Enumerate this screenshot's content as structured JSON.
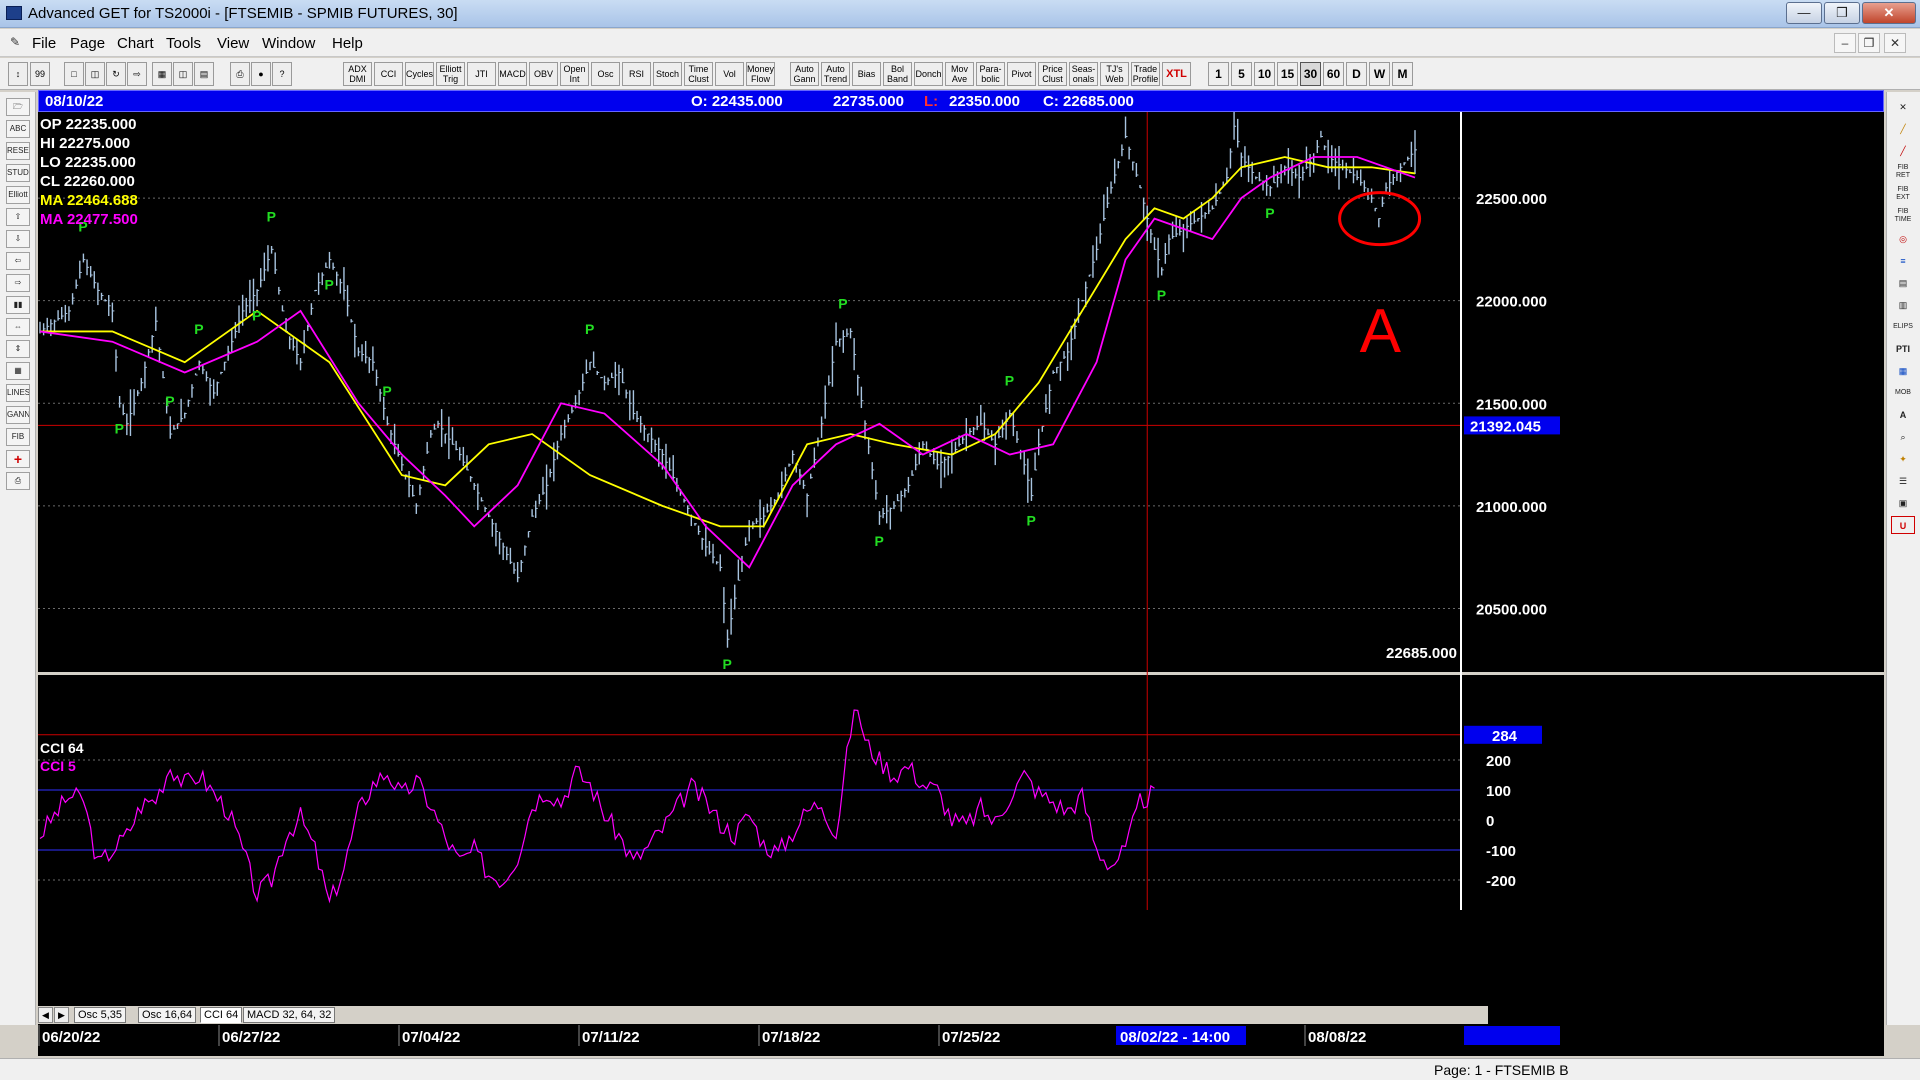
{
  "window": {
    "title": "Advanced GET for TS2000i - [FTSEMIB - SPMIB FUTURES, 30]",
    "minimize": "—",
    "restore": "❒",
    "close": "✕"
  },
  "menu": {
    "items": [
      "File",
      "Page",
      "Chart",
      "Tools",
      "View",
      "Window",
      "Help"
    ],
    "mdi_buttons": [
      "–",
      "❒",
      "✕"
    ]
  },
  "toolbar": {
    "indicator_buttons": [
      "ADX DMI",
      "CCI",
      "Cycles",
      "Elliott Trig",
      "JTI",
      "MACD",
      "OBV",
      "Open Int",
      "Osc",
      "RSI",
      "Stoch",
      "Time Clust",
      "Vol",
      "Money Flow",
      "Auto Gann",
      "Auto Trend",
      "Bias",
      "Bol Band",
      "Donch",
      "Mov Ave",
      "Para-bolic",
      "Pivot",
      "Price Clust",
      "Seas-onals",
      "TJ's Web",
      "Trade Profile",
      "XTL"
    ],
    "interval_buttons": [
      "1",
      "5",
      "10",
      "15",
      "30",
      "60",
      "D",
      "W",
      "M"
    ],
    "active_interval": "30"
  },
  "left_tools": [
    "open-folder",
    "ABC",
    "RESET",
    "STUDY",
    "Elliott",
    "⇧",
    "⇩",
    "⇦",
    "⇨",
    "bars",
    "⇔",
    "⇕",
    "grid",
    "LINES",
    "GANN",
    "FIB",
    "+",
    "print"
  ],
  "right_tools": [
    "✕",
    "╱",
    "╱",
    "FIB RET",
    "FIB EXT",
    "FIB TIME",
    "◎",
    "≡",
    "▤",
    "▥",
    "ELIPS",
    "PTI",
    "▦",
    "MOB",
    "A",
    "⌕",
    "✦",
    "☰",
    "▣",
    "U"
  ],
  "info_bar": {
    "date": "08/10/22",
    "open": "O: 22435.000",
    "high": "22735.000",
    "low_label": "L:",
    "low": "22350.000",
    "close": "C: 22685.000"
  },
  "readouts": {
    "op": "OP  22235.000",
    "hi": "HI   22275.000",
    "lo": "LO  22235.000",
    "cl": "CL  22260.000",
    "ma1": "MA  22464.688",
    "ma2": "MA  22477.500"
  },
  "price_axis": {
    "labels": [
      "22500.000",
      "22000.000",
      "21500.000",
      "21000.000",
      "20500.000"
    ],
    "cursor_price": "21392.045",
    "last_price": "22685.000"
  },
  "cci_panel": {
    "label1": "CCI 64",
    "label2": "CCI  5",
    "axis_labels": [
      "200",
      "100",
      "0",
      "-100",
      "-200"
    ],
    "cursor_value": "284"
  },
  "pivot_marker": "P",
  "annotation_letter": "A",
  "tabs": [
    "Osc 5,35",
    "Osc 16,64",
    "CCI 64",
    "MACD 32, 64, 32"
  ],
  "active_tab": "CCI 64",
  "tab_nav": [
    "◀",
    "▶"
  ],
  "date_axis": {
    "labels": [
      "06/20/22",
      "06/27/22",
      "07/04/22",
      "07/11/22",
      "07/18/22",
      "07/25/22",
      "08/08/22"
    ],
    "cursor_label": "08/02/22 - 14:00"
  },
  "status": "Page: 1 - FTSEMIB B",
  "colors": {
    "price_bars": "#a8c4e0",
    "ma_fast": "#ffff00",
    "ma_slow": "#ff00ff",
    "pivot": "#22dd22",
    "cursor_line": "#cc0000",
    "annotation": "#ff0000",
    "info_bar": "#0000ee"
  },
  "chart_data": {
    "type": "line",
    "title": "FTSEMIB - SPMIB FUTURES, 30",
    "x_range": [
      "06/20/22",
      "08/10/22"
    ],
    "y_range": [
      20200,
      22900
    ],
    "series": [
      {
        "name": "Price",
        "points": [
          [
            0,
            21850
          ],
          [
            2,
            21900
          ],
          [
            4,
            21950
          ],
          [
            6,
            22200
          ],
          [
            8,
            22050
          ],
          [
            10,
            21950
          ],
          [
            11,
            21500
          ],
          [
            12,
            21400
          ],
          [
            14,
            21600
          ],
          [
            16,
            21900
          ],
          [
            18,
            21350
          ],
          [
            20,
            21450
          ],
          [
            22,
            21700
          ],
          [
            24,
            21550
          ],
          [
            26,
            21750
          ],
          [
            28,
            21950
          ],
          [
            30,
            22050
          ],
          [
            32,
            22250
          ],
          [
            34,
            21850
          ],
          [
            36,
            21700
          ],
          [
            38,
            22050
          ],
          [
            40,
            22200
          ],
          [
            42,
            22050
          ],
          [
            44,
            21750
          ],
          [
            46,
            21700
          ],
          [
            48,
            21400
          ],
          [
            50,
            21200
          ],
          [
            52,
            21000
          ],
          [
            54,
            21350
          ],
          [
            55,
            21400
          ],
          [
            56,
            21350
          ],
          [
            58,
            21250
          ],
          [
            60,
            21100
          ],
          [
            62,
            20950
          ],
          [
            64,
            20800
          ],
          [
            66,
            20650
          ],
          [
            68,
            20950
          ],
          [
            70,
            21100
          ],
          [
            72,
            21350
          ],
          [
            74,
            21500
          ],
          [
            76,
            21700
          ],
          [
            78,
            21600
          ],
          [
            80,
            21650
          ],
          [
            82,
            21450
          ],
          [
            84,
            21350
          ],
          [
            86,
            21250
          ],
          [
            88,
            21100
          ],
          [
            90,
            20950
          ],
          [
            92,
            20800
          ],
          [
            94,
            20700
          ],
          [
            95,
            20350
          ],
          [
            96,
            20550
          ],
          [
            98,
            20900
          ],
          [
            100,
            20950
          ],
          [
            102,
            21050
          ],
          [
            104,
            21250
          ],
          [
            106,
            21050
          ],
          [
            108,
            21400
          ],
          [
            110,
            21800
          ],
          [
            112,
            21850
          ],
          [
            114,
            21400
          ],
          [
            116,
            20950
          ],
          [
            118,
            21000
          ],
          [
            120,
            21100
          ],
          [
            122,
            21300
          ],
          [
            124,
            21200
          ],
          [
            126,
            21250
          ],
          [
            128,
            21350
          ],
          [
            130,
            21400
          ],
          [
            132,
            21300
          ],
          [
            134,
            21450
          ],
          [
            136,
            21200
          ],
          [
            137,
            21050
          ],
          [
            138,
            21300
          ],
          [
            140,
            21650
          ],
          [
            142,
            21750
          ],
          [
            144,
            22000
          ],
          [
            146,
            22250
          ],
          [
            148,
            22550
          ],
          [
            150,
            22800
          ],
          [
            152,
            22550
          ],
          [
            154,
            22250
          ],
          [
            155,
            22150
          ],
          [
            156,
            22300
          ],
          [
            158,
            22350
          ],
          [
            160,
            22400
          ],
          [
            162,
            22450
          ],
          [
            164,
            22600
          ],
          [
            165,
            22850
          ],
          [
            166,
            22700
          ],
          [
            168,
            22600
          ],
          [
            170,
            22550
          ],
          [
            172,
            22650
          ],
          [
            174,
            22600
          ],
          [
            176,
            22700
          ],
          [
            177,
            22800
          ],
          [
            178,
            22700
          ],
          [
            180,
            22650
          ],
          [
            182,
            22600
          ],
          [
            184,
            22500
          ],
          [
            185,
            22400
          ],
          [
            186,
            22550
          ],
          [
            188,
            22650
          ],
          [
            190,
            22735
          ]
        ]
      },
      {
        "name": "MA",
        "points": [
          [
            0,
            21850
          ],
          [
            10,
            21850
          ],
          [
            20,
            21700
          ],
          [
            30,
            21950
          ],
          [
            40,
            21700
          ],
          [
            50,
            21150
          ],
          [
            56,
            21100
          ],
          [
            62,
            21300
          ],
          [
            68,
            21350
          ],
          [
            76,
            21150
          ],
          [
            86,
            21000
          ],
          [
            94,
            20900
          ],
          [
            100,
            20900
          ],
          [
            106,
            21300
          ],
          [
            112,
            21350
          ],
          [
            118,
            21300
          ],
          [
            126,
            21250
          ],
          [
            132,
            21350
          ],
          [
            138,
            21600
          ],
          [
            144,
            21950
          ],
          [
            150,
            22300
          ],
          [
            154,
            22450
          ],
          [
            158,
            22400
          ],
          [
            162,
            22500
          ],
          [
            166,
            22650
          ],
          [
            172,
            22700
          ],
          [
            178,
            22650
          ],
          [
            184,
            22650
          ],
          [
            190,
            22620
          ]
        ]
      },
      {
        "name": "MA",
        "points": [
          [
            0,
            21850
          ],
          [
            10,
            21800
          ],
          [
            20,
            21650
          ],
          [
            30,
            21800
          ],
          [
            36,
            21950
          ],
          [
            44,
            21500
          ],
          [
            50,
            21250
          ],
          [
            56,
            21050
          ],
          [
            60,
            20900
          ],
          [
            66,
            21100
          ],
          [
            72,
            21500
          ],
          [
            78,
            21450
          ],
          [
            86,
            21200
          ],
          [
            92,
            20900
          ],
          [
            98,
            20700
          ],
          [
            104,
            21100
          ],
          [
            110,
            21300
          ],
          [
            116,
            21400
          ],
          [
            122,
            21250
          ],
          [
            128,
            21350
          ],
          [
            134,
            21250
          ],
          [
            140,
            21300
          ],
          [
            146,
            21700
          ],
          [
            150,
            22200
          ],
          [
            154,
            22400
          ],
          [
            158,
            22350
          ],
          [
            162,
            22300
          ],
          [
            166,
            22500
          ],
          [
            170,
            22600
          ],
          [
            176,
            22700
          ],
          [
            182,
            22700
          ],
          [
            190,
            22600
          ]
        ]
      }
    ],
    "pivots": [
      {
        "x": 6,
        "type": "high"
      },
      {
        "x": 11,
        "type": "low"
      },
      {
        "x": 18,
        "type": "high"
      },
      {
        "x": 22,
        "type": "high"
      },
      {
        "x": 30,
        "type": "low"
      },
      {
        "x": 32,
        "type": "high"
      },
      {
        "x": 40,
        "type": "low"
      },
      {
        "x": 48,
        "type": "high"
      },
      {
        "x": 95,
        "type": "low"
      },
      {
        "x": 76,
        "type": "high"
      },
      {
        "x": 111,
        "type": "high"
      },
      {
        "x": 116,
        "type": "low"
      },
      {
        "x": 137,
        "type": "low"
      },
      {
        "x": 134,
        "type": "high"
      },
      {
        "x": 155,
        "type": "low"
      },
      {
        "x": 150,
        "type": "high"
      },
      {
        "x": 170,
        "type": "low"
      },
      {
        "x": 177,
        "type": "high"
      }
    ],
    "cci": {
      "name": "CCI",
      "points": [
        [
          0,
          -50
        ],
        [
          4,
          80
        ],
        [
          6,
          70
        ],
        [
          8,
          -150
        ],
        [
          10,
          -100
        ],
        [
          12,
          -50
        ],
        [
          14,
          50
        ],
        [
          16,
          70
        ],
        [
          18,
          180
        ],
        [
          20,
          120
        ],
        [
          22,
          150
        ],
        [
          24,
          90
        ],
        [
          26,
          30
        ],
        [
          28,
          -100
        ],
        [
          30,
          -250
        ],
        [
          32,
          -200
        ],
        [
          34,
          -50
        ],
        [
          36,
          10
        ],
        [
          38,
          -100
        ],
        [
          40,
          -280
        ],
        [
          42,
          -160
        ],
        [
          44,
          30
        ],
        [
          46,
          120
        ],
        [
          48,
          160
        ],
        [
          50,
          80
        ],
        [
          52,
          130
        ],
        [
          54,
          50
        ],
        [
          56,
          -60
        ],
        [
          58,
          -140
        ],
        [
          60,
          -100
        ],
        [
          62,
          -180
        ],
        [
          64,
          -200
        ],
        [
          66,
          -120
        ],
        [
          68,
          50
        ],
        [
          70,
          100
        ],
        [
          72,
          60
        ],
        [
          74,
          160
        ],
        [
          76,
          120
        ],
        [
          78,
          20
        ],
        [
          80,
          -50
        ],
        [
          82,
          -140
        ],
        [
          84,
          -90
        ],
        [
          86,
          -30
        ],
        [
          88,
          40
        ],
        [
          90,
          110
        ],
        [
          92,
          60
        ],
        [
          94,
          -10
        ],
        [
          96,
          -50
        ],
        [
          98,
          20
        ],
        [
          100,
          -80
        ],
        [
          102,
          -110
        ],
        [
          104,
          -40
        ],
        [
          106,
          30
        ],
        [
          108,
          60
        ],
        [
          110,
          -50
        ],
        [
          112,
          300
        ],
        [
          113,
          380
        ],
        [
          114,
          260
        ],
        [
          116,
          200
        ],
        [
          118,
          150
        ],
        [
          120,
          180
        ],
        [
          122,
          120
        ],
        [
          124,
          100
        ],
        [
          126,
          0
        ],
        [
          128,
          -20
        ],
        [
          130,
          40
        ],
        [
          132,
          -10
        ],
        [
          134,
          80
        ],
        [
          136,
          150
        ],
        [
          138,
          90
        ],
        [
          140,
          60
        ],
        [
          142,
          30
        ],
        [
          144,
          80
        ],
        [
          146,
          -100
        ],
        [
          148,
          -150
        ],
        [
          150,
          -100
        ],
        [
          152,
          60
        ],
        [
          154,
          90
        ]
      ]
    }
  }
}
